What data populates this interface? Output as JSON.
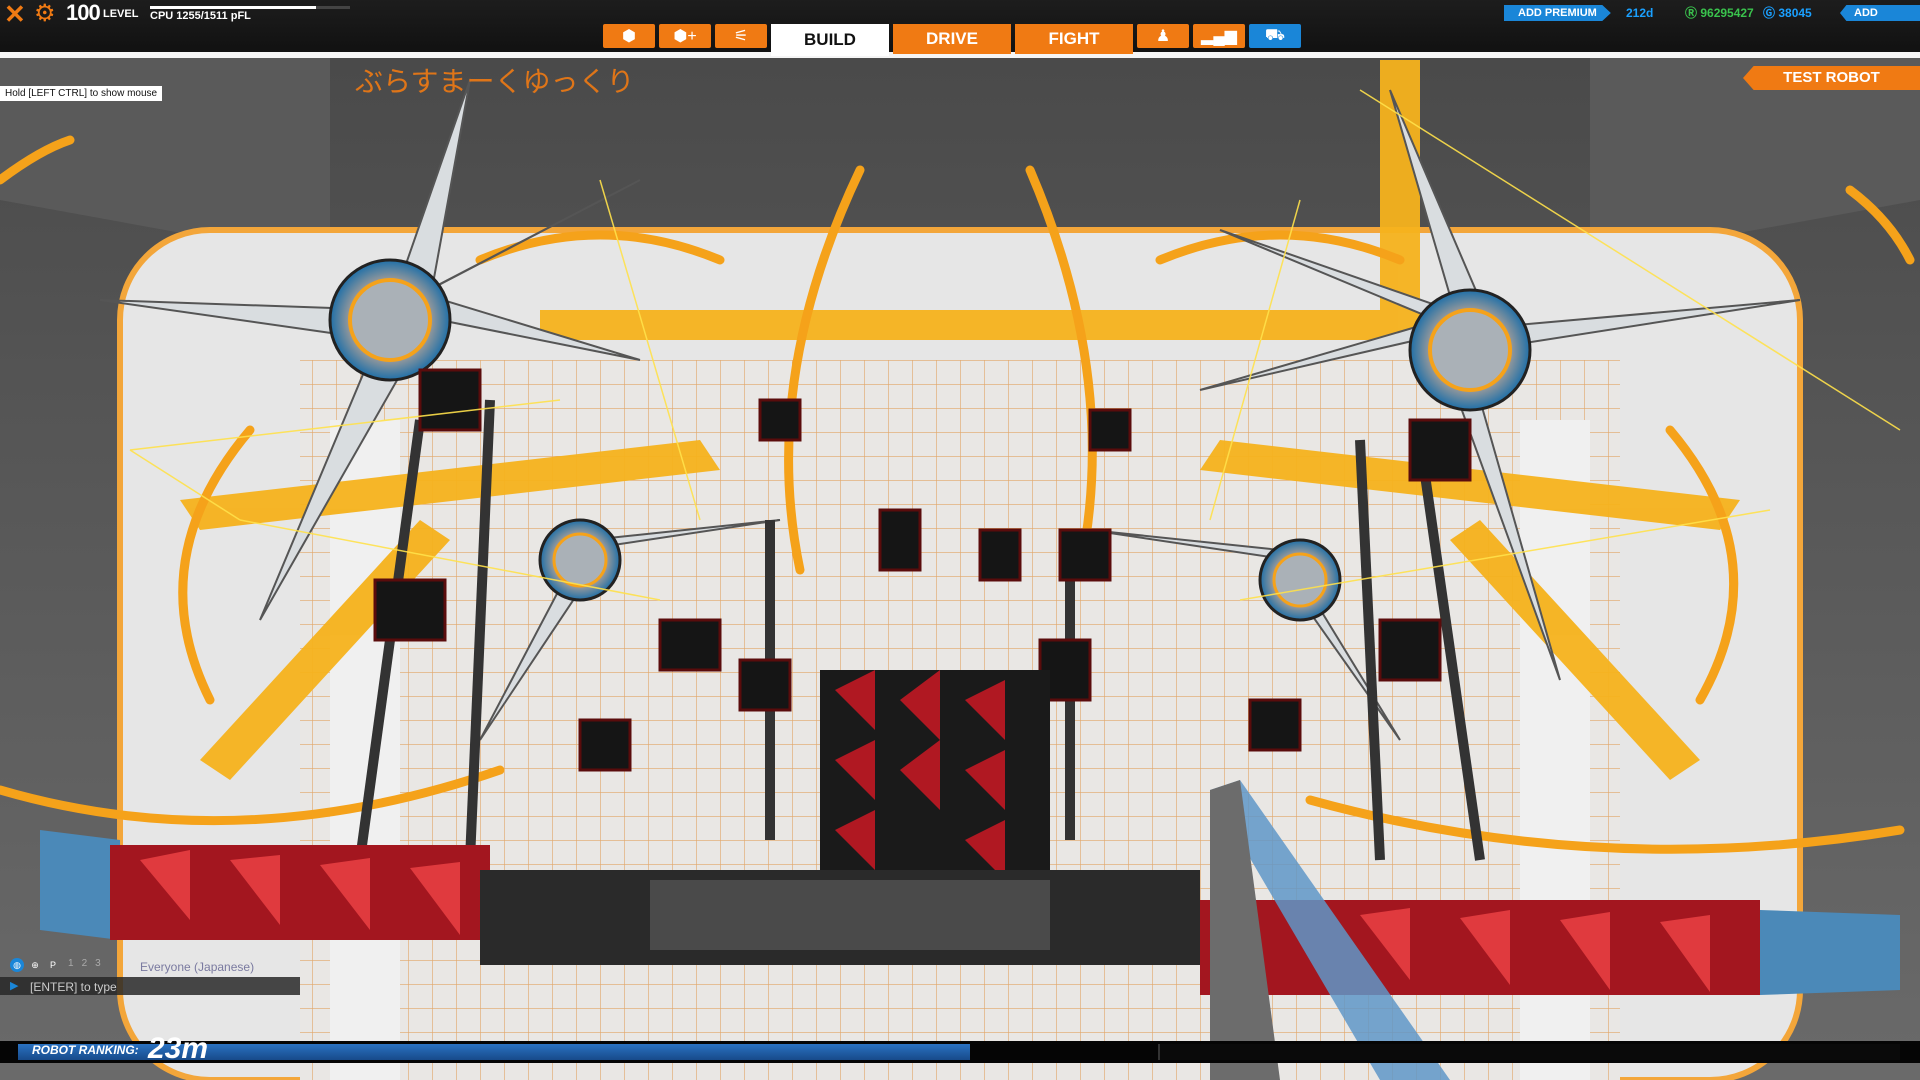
{
  "hud": {
    "level_value": "100",
    "level_label": "LEVEL",
    "cpu_text": "CPU 1255/1511 pFL",
    "cpu_fraction": 0.83
  },
  "tabs": {
    "build": "BUILD",
    "drive": "DRIVE",
    "fight": "FIGHT"
  },
  "account": {
    "add_premium": "ADD PREMIUM",
    "premium_days": "212d",
    "robits": "96295427",
    "galaxy_cash": "38045",
    "add_funds": "ADD FUNDS"
  },
  "hint_text": "Hold [LEFT CTRL] to show mouse",
  "test_robot": "TEST ROBOT",
  "scene_text": "ぶらすまーくゆっくり",
  "chat": {
    "tabs": [
      "1",
      "2",
      "3"
    ],
    "channel": "Everyone (Japanese)",
    "input_placeholder": "[ENTER] to type"
  },
  "ranking": {
    "label": "ROBOT RANKING:",
    "value": "23m",
    "fraction": 0.52
  },
  "colors": {
    "accent_orange": "#f07a13",
    "accent_blue": "#1a86d8",
    "robits_green": "#3ac24d"
  }
}
